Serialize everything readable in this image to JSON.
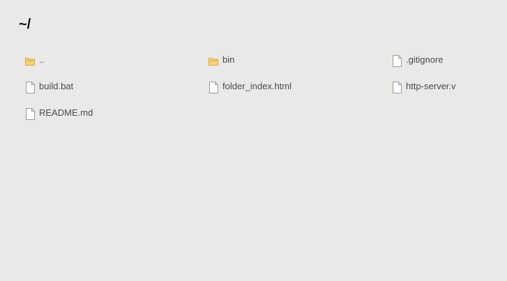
{
  "page": {
    "title": "~/"
  },
  "entries": [
    {
      "name": "..",
      "kind": "folder",
      "icon": "folder-icon"
    },
    {
      "name": "bin",
      "kind": "folder",
      "icon": "folder-icon"
    },
    {
      "name": ".gitignore",
      "kind": "file",
      "icon": "file-icon"
    },
    {
      "name": "build.bat",
      "kind": "file",
      "icon": "file-icon"
    },
    {
      "name": "folder_index.html",
      "kind": "file",
      "icon": "file-icon"
    },
    {
      "name": "http-server.v",
      "kind": "file",
      "icon": "file-icon"
    },
    {
      "name": "README.md",
      "kind": "file",
      "icon": "file-icon"
    }
  ],
  "colors": {
    "background": "#eae9e7",
    "folder_fill": "#f6d27a",
    "folder_stroke": "#d9a640",
    "file_fill": "#ffffff",
    "file_stroke": "#9a9a9a",
    "text": "#4a4a4a"
  }
}
